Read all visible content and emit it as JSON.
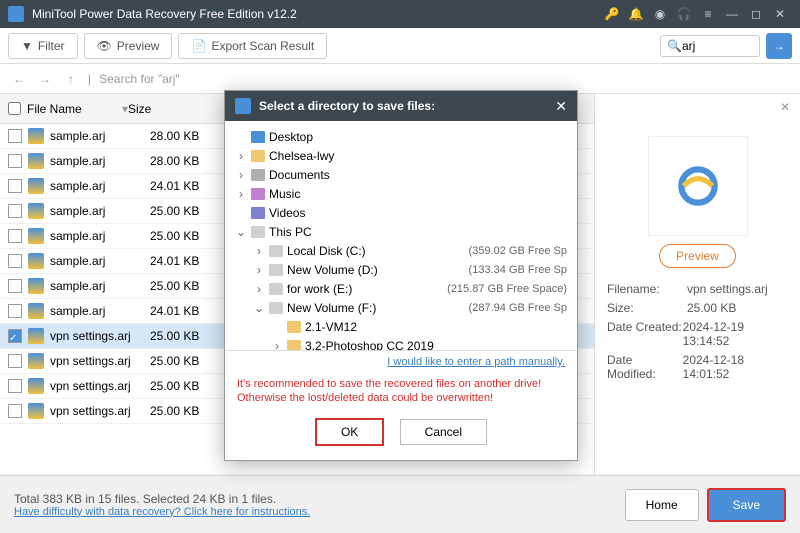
{
  "app": {
    "title": "MiniTool Power Data Recovery Free Edition v12.2"
  },
  "toolbar": {
    "filter": "Filter",
    "preview": "Preview",
    "export": "Export Scan Result"
  },
  "search": {
    "placeholder": "arj",
    "value": "arj"
  },
  "nav": {
    "searchfor": "Search for  \"arj\""
  },
  "columns": {
    "filename": "File Name",
    "size": "Size"
  },
  "files": [
    {
      "name": "sample.arj",
      "size": "28.00 KB",
      "sel": false
    },
    {
      "name": "sample.arj",
      "size": "28.00 KB",
      "sel": false
    },
    {
      "name": "sample.arj",
      "size": "24.01 KB",
      "sel": false
    },
    {
      "name": "sample.arj",
      "size": "25.00 KB",
      "sel": false
    },
    {
      "name": "sample.arj",
      "size": "25.00 KB",
      "sel": false
    },
    {
      "name": "sample.arj",
      "size": "24.01 KB",
      "sel": false
    },
    {
      "name": "sample.arj",
      "size": "25.00 KB",
      "sel": false
    },
    {
      "name": "sample.arj",
      "size": "24.01 KB",
      "sel": false
    },
    {
      "name": "vpn settings.arj",
      "size": "25.00 KB",
      "sel": true
    },
    {
      "name": "vpn settings.arj",
      "size": "25.00 KB",
      "sel": false
    },
    {
      "name": "vpn settings.arj",
      "size": "25.00 KB",
      "sel": false
    },
    {
      "name": "vpn settings.arj",
      "size": "25.00 KB",
      "sel": false
    }
  ],
  "preview": {
    "button": "Preview",
    "filename_k": "Filename:",
    "filename_v": "vpn settings.arj",
    "size_k": "Size:",
    "size_v": "25.00 KB",
    "created_k": "Date Created:",
    "created_v": "2024-12-19 13:14:52",
    "modified_k": "Date Modified:",
    "modified_v": "2024-12-18 14:01:52"
  },
  "footer": {
    "total": "Total 383 KB in 15 files.  Selected 24 KB in 1 files.",
    "help": "Have difficulty with data recovery? Click here for instructions.",
    "home": "Home",
    "save": "Save"
  },
  "modal": {
    "title": "Select a directory to save files:",
    "tree": [
      {
        "indent": 0,
        "exp": "",
        "icon": "desktop",
        "label": "Desktop",
        "free": ""
      },
      {
        "indent": 0,
        "exp": "›",
        "icon": "folder",
        "label": "Chelsea-lwy",
        "free": ""
      },
      {
        "indent": 0,
        "exp": "›",
        "icon": "doc",
        "label": "Documents",
        "free": ""
      },
      {
        "indent": 0,
        "exp": "›",
        "icon": "music",
        "label": "Music",
        "free": ""
      },
      {
        "indent": 0,
        "exp": "",
        "icon": "video",
        "label": "Videos",
        "free": ""
      },
      {
        "indent": 0,
        "exp": "⌄",
        "icon": "drive",
        "label": "This PC",
        "free": ""
      },
      {
        "indent": 1,
        "exp": "›",
        "icon": "drive",
        "label": "Local Disk (C:)",
        "free": "(359.02 GB Free Sp"
      },
      {
        "indent": 1,
        "exp": "›",
        "icon": "drive",
        "label": "New Volume (D:)",
        "free": "(133.34 GB Free Sp"
      },
      {
        "indent": 1,
        "exp": "›",
        "icon": "drive",
        "label": "for work (E:)",
        "free": "(215.87 GB Free Space)"
      },
      {
        "indent": 1,
        "exp": "⌄",
        "icon": "drive",
        "label": "New Volume (F:)",
        "free": "(287.94 GB Free Sp"
      },
      {
        "indent": 2,
        "exp": "",
        "icon": "folder",
        "label": "2.1-VM12",
        "free": ""
      },
      {
        "indent": 2,
        "exp": "›",
        "icon": "folder",
        "label": "3.2-Photoshop CC 2019",
        "free": ""
      }
    ],
    "manual": "I would like to enter a path manually.",
    "warning": "It's recommended to save the recovered files on another drive! Otherwise the lost/deleted data could be overwritten!",
    "ok": "OK",
    "cancel": "Cancel"
  }
}
